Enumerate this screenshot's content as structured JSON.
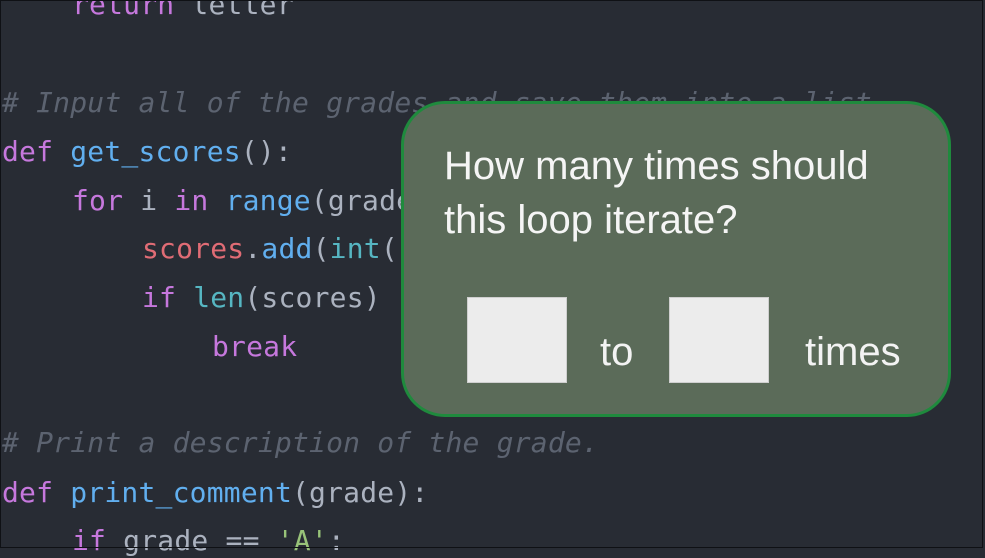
{
  "code": {
    "line_return": [
      "return",
      " letter"
    ],
    "comment_input": "# Input all of the grades and save them into a list",
    "line_def1": [
      "def",
      " ",
      "get_scores",
      "():"
    ],
    "line_for": [
      "for",
      " i ",
      "in",
      " ",
      "range",
      "(grade"
    ],
    "line_add": [
      "scores",
      ".",
      "add",
      "(",
      "int",
      "("
    ],
    "line_if": [
      "if",
      " ",
      "len",
      "(scores)"
    ],
    "line_break": "break",
    "comment_print": "# Print a description of the grade.",
    "line_def2": [
      "def",
      " ",
      "print_comment",
      "(grade):"
    ],
    "line_ifgrade": [
      "if",
      " grade == ",
      "'A'",
      ":"
    ]
  },
  "overlay": {
    "question": "How many times should this loop iterate?",
    "min_value": "",
    "to_label": "to",
    "max_value": "",
    "times_label": "times",
    "colors": {
      "background": "#5b6b59",
      "border": "#1f8a3d"
    }
  }
}
